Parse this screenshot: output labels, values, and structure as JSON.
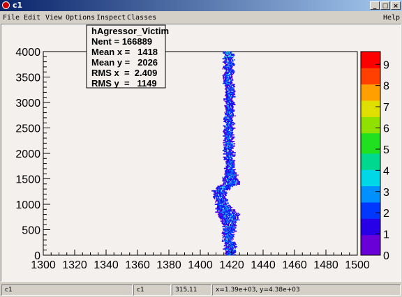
{
  "window": {
    "title": "c1",
    "buttons": [
      "_",
      "□",
      "×"
    ]
  },
  "menu": {
    "items": [
      "File",
      "Edit",
      "View",
      "Options",
      "Inspect",
      "Classes"
    ],
    "help": "Help"
  },
  "stats": {
    "name": "hAgressor_Victim",
    "lines": [
      "Nent = 166889",
      "Mean x =   1418",
      "Mean y =   2026",
      "RMS x  =  2.409",
      "RMS y  =   1149"
    ]
  },
  "status": {
    "cells": [
      "c1",
      "c1",
      "315,11",
      "x=1.39e+03, y=4.38e+03"
    ]
  },
  "chart_data": {
    "type": "heatmap",
    "xlim": [
      1300,
      1500
    ],
    "ylim": [
      0,
      4000
    ],
    "x_tick_labels": [
      "1300",
      "1320",
      "1340",
      "1360",
      "1380",
      "1400",
      "1420",
      "1440",
      "1460",
      "1480",
      "1500"
    ],
    "y_tick_labels": [
      "0",
      "500",
      "1000",
      "1500",
      "2000",
      "2500",
      "3000",
      "3500",
      "4000"
    ],
    "z_tick_labels": [
      "0",
      "1",
      "2",
      "3",
      "4",
      "5",
      "6",
      "7",
      "8",
      "9"
    ],
    "zlim": [
      0,
      9.6
    ],
    "band_profile": [
      {
        "y": 0,
        "xmin": 1416,
        "xmax": 1422
      },
      {
        "y": 200,
        "xmin": 1415,
        "xmax": 1422
      },
      {
        "y": 400,
        "xmin": 1414,
        "xmax": 1421
      },
      {
        "y": 600,
        "xmin": 1415,
        "xmax": 1423
      },
      {
        "y": 800,
        "xmin": 1410,
        "xmax": 1424
      },
      {
        "y": 1000,
        "xmin": 1410,
        "xmax": 1417
      },
      {
        "y": 1250,
        "xmin": 1408,
        "xmax": 1416
      },
      {
        "y": 1400,
        "xmin": 1414,
        "xmax": 1425
      },
      {
        "y": 1700,
        "xmin": 1416,
        "xmax": 1421
      },
      {
        "y": 2200,
        "xmin": 1415,
        "xmax": 1421
      },
      {
        "y": 2800,
        "xmin": 1416,
        "xmax": 1421
      },
      {
        "y": 3400,
        "xmin": 1415,
        "xmax": 1421
      },
      {
        "y": 4000,
        "xmin": 1415,
        "xmax": 1421
      }
    ],
    "colors": {
      "frame_bg": "#f4f0ee",
      "palette": [
        "#6a00d8",
        "#2800e8",
        "#0038ff",
        "#0090ff",
        "#00d8e8",
        "#00d890",
        "#20e020",
        "#90e000",
        "#e0e000",
        "#ffa000",
        "#ff4000",
        "#ff0000"
      ]
    }
  }
}
